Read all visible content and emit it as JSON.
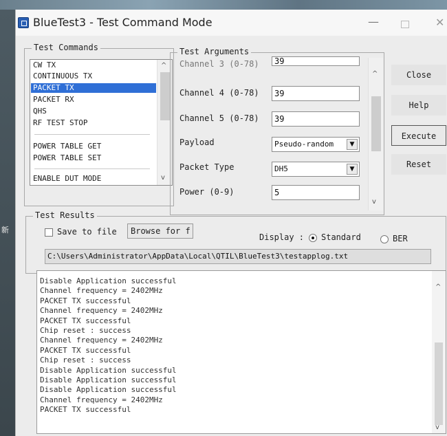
{
  "window": {
    "title": "BlueTest3 - Test Command Mode",
    "minimize_glyph": "—",
    "close_glyph": "✕"
  },
  "side_note": "新",
  "commands": {
    "legend": "Test Commands",
    "items": [
      "CW TX",
      "CONTINUOUS TX",
      "PACKET TX",
      "PACKET RX",
      "QHS",
      "RF TEST STOP",
      "POWER TABLE GET",
      "POWER TABLE SET",
      "ENABLE DUT MODE"
    ],
    "selected": "PACKET TX"
  },
  "arguments": {
    "legend": "Test Arguments",
    "cut_label": "Channel 3 (0-78)",
    "cut_value": "39",
    "channel4_label": "Channel 4 (0-78)",
    "channel4_value": "39",
    "channel5_label": "Channel 5 (0-78)",
    "channel5_value": "39",
    "payload_label": "Payload",
    "payload_value": "Pseudo-random",
    "packet_type_label": "Packet Type",
    "packet_type_value": "DH5",
    "power_label": "Power (0-9)",
    "power_value": "5"
  },
  "buttons": {
    "close": "Close",
    "help": "Help",
    "execute": "Execute",
    "reset": "Reset"
  },
  "results": {
    "legend": "Test Results",
    "save_to_file_label": "Save to file",
    "browse_label": "Browse for f",
    "display_label": "Display :",
    "standard_label": "Standard",
    "ber_label": "BER",
    "display_mode": "Standard",
    "log_path": "C:\\Users\\Administrator\\AppData\\Local\\QTIL\\BlueTest3\\testapplog.txt"
  },
  "log_lines": [
    "Disable Application successful",
    "Channel frequency = 2402MHz",
    "PACKET TX successful",
    "Channel frequency = 2402MHz",
    "PACKET TX successful",
    "Chip reset : success",
    "Channel frequency = 2402MHz",
    "PACKET TX successful",
    "Chip reset : success",
    "Disable Application successful",
    "Disable Application successful",
    "Disable Application successful",
    "Channel frequency = 2402MHz",
    "PACKET TX successful"
  ],
  "icons": {
    "scroll_up": "▲",
    "scroll_down": "▼",
    "chevron_up": "^",
    "chevron_down": "v"
  }
}
